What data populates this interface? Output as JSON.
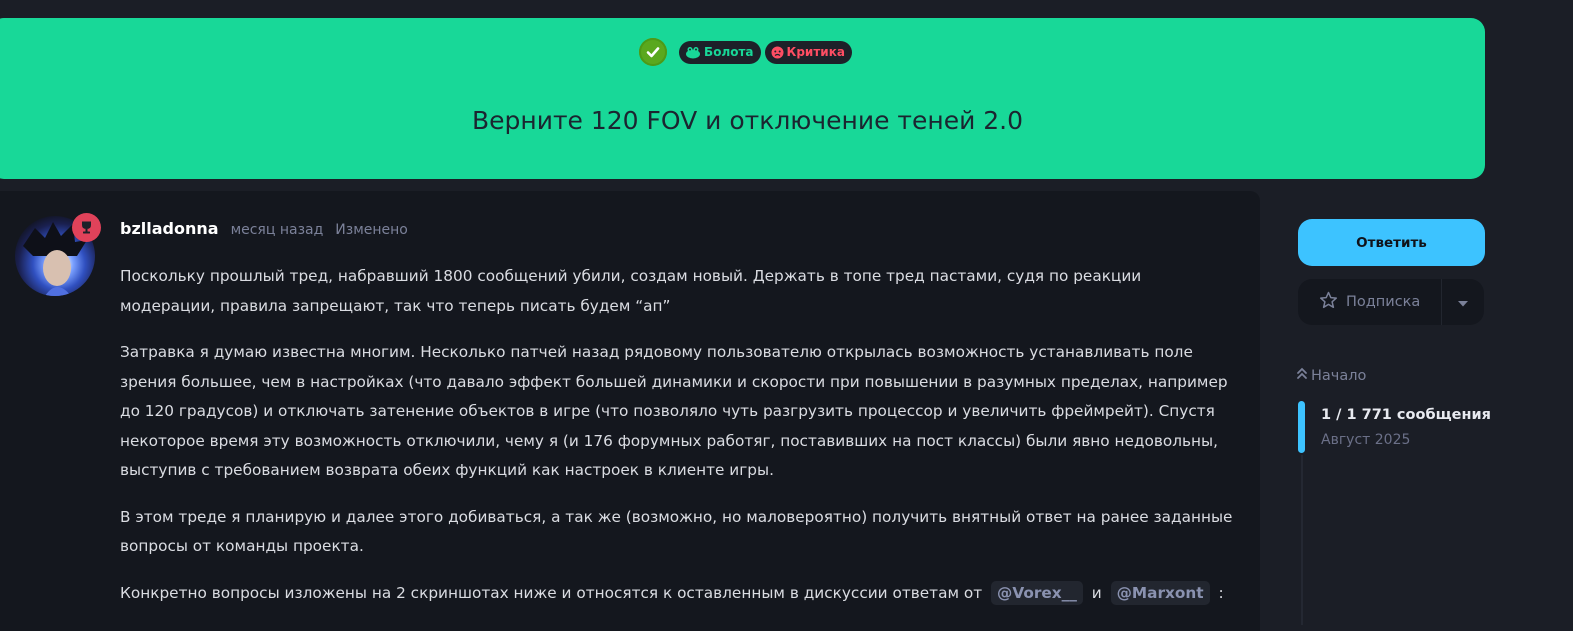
{
  "topic": {
    "title": "Верните 120 FOV и отключение теней 2.0",
    "tags": [
      {
        "label": "Болота",
        "color": "#18d898",
        "icon": "frog-icon"
      },
      {
        "label": "Критика",
        "color": "#ff4d63",
        "icon": "angry-face-icon"
      }
    ],
    "solved_icon": "check-circle-icon"
  },
  "post": {
    "author": "bzlladonna",
    "time": "месяц назад",
    "edited": "Изменено",
    "paragraphs": [
      "Поскольку прошлый тред, набравший 1800 сообщений убили, создам новый. Держать в топе тред пастами, судя по реакции модерации, правила запрещают, так что теперь писать будем “ап”",
      "Затравка я думаю известна многим. Несколько патчей назад рядовому пользователю открылась возможность устанавливать поле зрения большее, чем в настройках (что давало эффект большей динамики и скорости при повышении в разумных пределах, например до 120 градусов) и отключать затенение объектов в игре (что позволяло чуть разгрузить процессор и увеличить фреймрейт). Спустя некоторое время эту возможность отключили, чему я (и 176 форумных работяг, поставивших на пост классы) были явно недовольны, выступив с требованием возврата обеих функций как настроек в клиенте игры.",
      "В этом треде я планирую и далее этого добиваться, а так же (возможно, но маловероятно) получить внятный ответ на ранее заданные вопросы от команды проекта."
    ],
    "last_paragraph": {
      "before": "Конкретно вопросы изложены на 2 скриншотах ниже и относятся к оставленным в дискуссии ответам от",
      "mention1": "@Vorex__",
      "between": "и",
      "mention2": "@Marxont",
      "after": ":"
    }
  },
  "sidebar": {
    "reply_label": "Ответить",
    "subscribe_label": "Подписка",
    "timeline_top": "Начало",
    "timeline_count": "1 / 1 771 сообщения",
    "timeline_date": "Август 2025"
  }
}
